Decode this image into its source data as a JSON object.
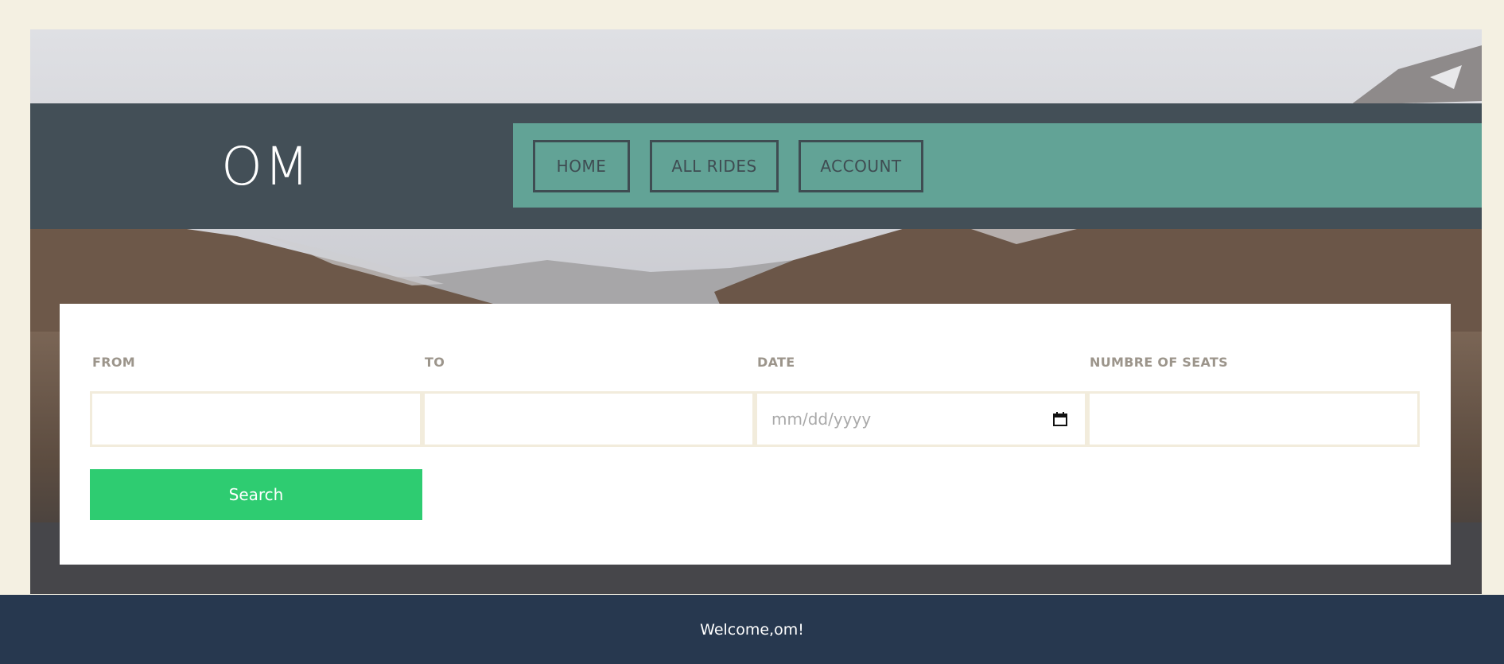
{
  "header": {
    "logo": "OM",
    "nav": [
      {
        "label": "HOME"
      },
      {
        "label": "ALL RIDES"
      },
      {
        "label": "ACCOUNT"
      }
    ]
  },
  "search": {
    "fields": [
      {
        "label": "FROM",
        "value": ""
      },
      {
        "label": "TO",
        "value": ""
      },
      {
        "label": "DATE",
        "placeholder": "mm/dd/yyyy"
      },
      {
        "label": "NUMBRE OF SEATS",
        "value": ""
      }
    ],
    "button_label": "Search"
  },
  "footer": {
    "welcome": "Welcome,om!"
  },
  "colors": {
    "page_bg": "#f4f0e2",
    "header_bg": "#434f57",
    "nav_panel_bg": "#62a396",
    "search_button_bg": "#2ecc71",
    "footer_bg": "#27384f"
  }
}
